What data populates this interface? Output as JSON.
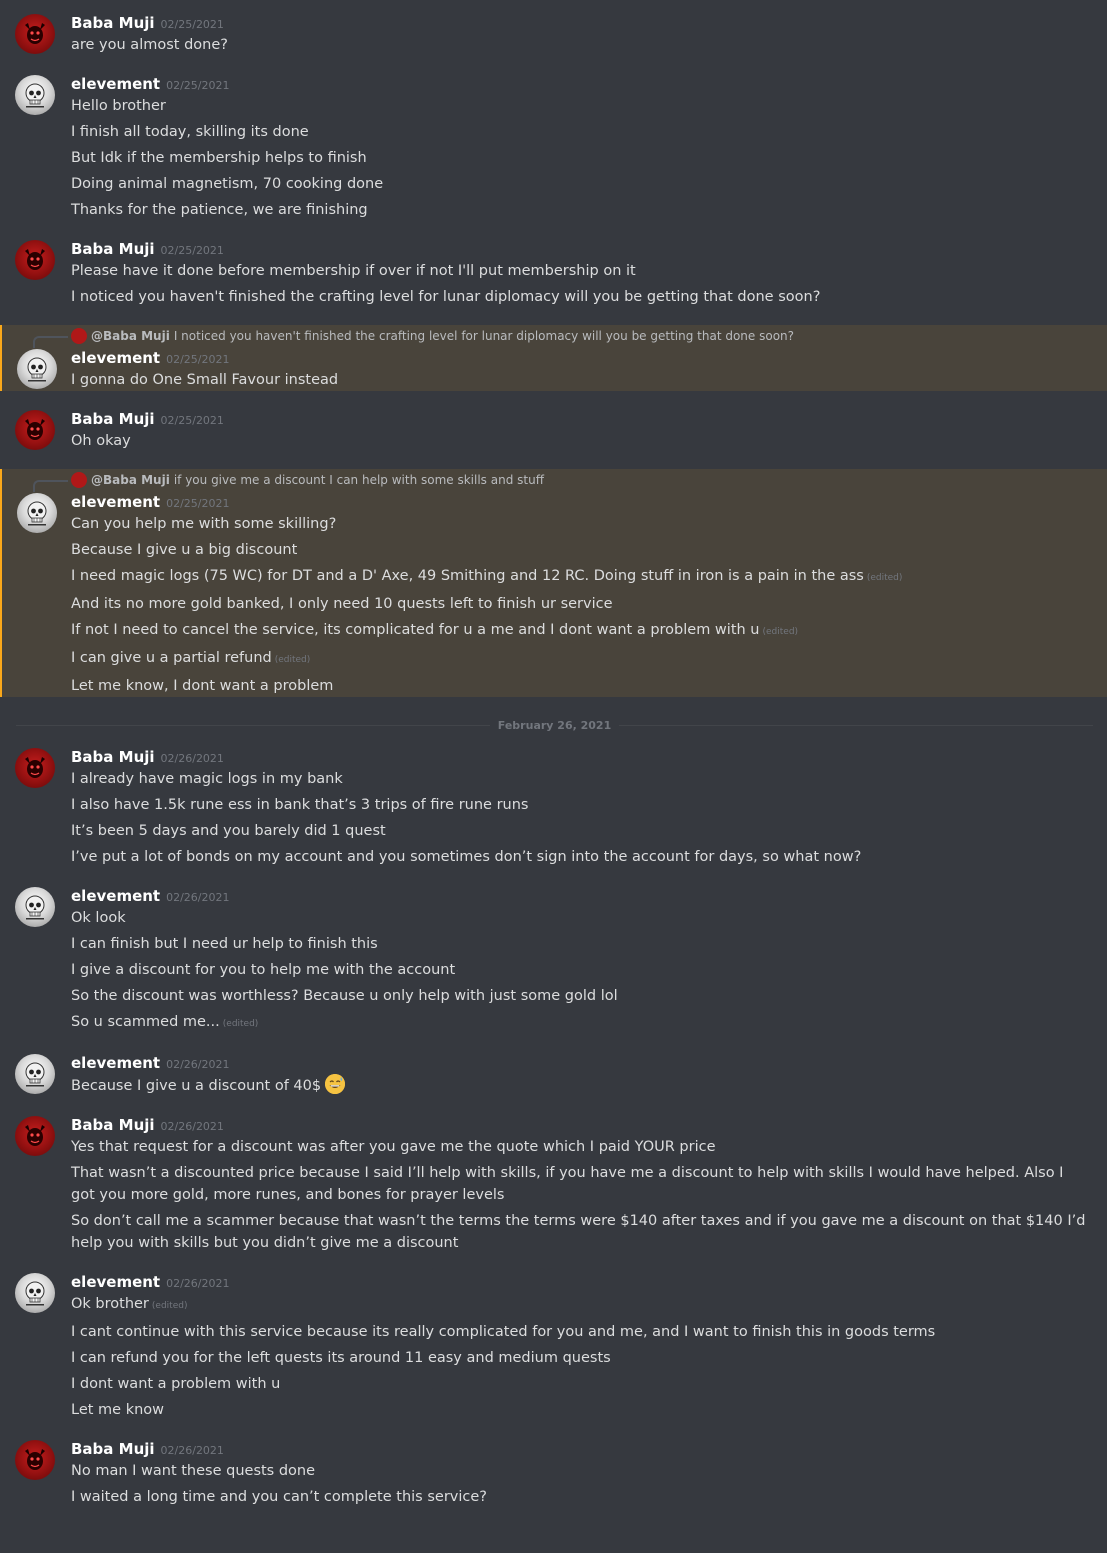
{
  "colors": {
    "background": "#36393f",
    "text": "#dcddde",
    "author": "#ffffff",
    "timestamp": "#72767d",
    "mention_highlight": "#faa81a",
    "baba_avatar": "#b01818",
    "elev_avatar": "#d9d9d9"
  },
  "edited_label": "(edited)",
  "date_divider": "February 26, 2021",
  "groups": [
    {
      "author": "Baba Muji",
      "avatar": "baba",
      "timestamp": "02/25/2021",
      "messages": [
        {
          "text": "are you almost done?"
        }
      ]
    },
    {
      "author": "elevement",
      "avatar": "elev",
      "timestamp": "02/25/2021",
      "messages": [
        {
          "text": "Hello brother"
        },
        {
          "text": "I finish all today, skilling its done"
        },
        {
          "text": "But Idk if the membership helps to finish"
        },
        {
          "text": "Doing animal magnetism, 70 cooking done"
        },
        {
          "text": "Thanks for the patience, we are finishing"
        }
      ]
    },
    {
      "author": "Baba Muji",
      "avatar": "baba",
      "timestamp": "02/25/2021",
      "messages": [
        {
          "text": "Please have it done before membership if over if not I'll put membership on it"
        },
        {
          "text": "I noticed you haven't finished the crafting level for lunar diplomacy will you be getting that done soon?"
        }
      ]
    },
    {
      "author": "elevement",
      "avatar": "elev",
      "timestamp": "02/25/2021",
      "reply": {
        "author": "@Baba Muji",
        "text": "I noticed you haven't finished the crafting level for lunar diplomacy will you be getting that done soon?"
      },
      "messages": [
        {
          "text": "I gonna do One Small Favour instead"
        }
      ]
    },
    {
      "author": "Baba Muji",
      "avatar": "baba",
      "timestamp": "02/25/2021",
      "messages": [
        {
          "text": "Oh okay"
        }
      ]
    },
    {
      "author": "elevement",
      "avatar": "elev",
      "timestamp": "02/25/2021",
      "reply": {
        "author": "@Baba Muji",
        "text": "if you give me a discount I can help with some skills and stuff"
      },
      "messages": [
        {
          "text": "Can you help me with some skilling?"
        },
        {
          "text": "Because I give u a big discount"
        },
        {
          "text": "I need magic logs (75 WC) for DT and a D' Axe, 49 Smithing and 12 RC. Doing stuff in iron is a pain in the ass",
          "edited": true
        },
        {
          "text": "And its no more gold banked, I only need 10 quests left to finish ur service"
        },
        {
          "text": "If not I need to cancel the service, its complicated for u a me and I dont want a problem with u",
          "edited": true
        },
        {
          "text": "I can give u a partial refund",
          "edited": true
        },
        {
          "text": "Let me know, I dont want a problem"
        }
      ]
    },
    {
      "divider": true
    },
    {
      "author": "Baba Muji",
      "avatar": "baba",
      "timestamp": "02/26/2021",
      "messages": [
        {
          "text": "I already have magic logs in my bank"
        },
        {
          "text": "I also have 1.5k rune ess in bank that’s 3 trips of fire rune runs"
        },
        {
          "text": "It’s been 5 days and you barely did 1 quest"
        },
        {
          "text": "I’ve put a lot of bonds on my account and you sometimes don’t sign into the account for days, so what now?"
        }
      ]
    },
    {
      "author": "elevement",
      "avatar": "elev",
      "timestamp": "02/26/2021",
      "messages": [
        {
          "text": "Ok look"
        },
        {
          "text": "I can finish but I need ur help to finish this"
        },
        {
          "text": "I give a discount for you to help me with the account"
        },
        {
          "text": "So the discount was worthless? Because u only help with just some gold lol"
        },
        {
          "text": "So u scammed me...",
          "edited": true
        }
      ]
    },
    {
      "author": "elevement",
      "avatar": "elev",
      "timestamp": "02/26/2021",
      "messages": [
        {
          "text": "Because I give u a discount of 40$",
          "emoji": "grinning-sweat-emoji"
        }
      ]
    },
    {
      "author": "Baba Muji",
      "avatar": "baba",
      "timestamp": "02/26/2021",
      "messages": [
        {
          "text": "Yes that request for a discount was after you gave me the quote which I paid YOUR price"
        },
        {
          "text": "That wasn’t a discounted price because I said I’ll help with skills, if you have me a discount to help with skills I would have helped. Also I got you more gold, more runes, and bones for prayer levels"
        },
        {
          "text": "So don’t call me a scammer because that wasn’t the terms the terms were $140 after taxes and if you gave me a discount on that $140 I’d help you with skills but you didn’t give me a discount"
        }
      ]
    },
    {
      "author": "elevement",
      "avatar": "elev",
      "timestamp": "02/26/2021",
      "messages": [
        {
          "text": "Ok brother",
          "edited": true
        },
        {
          "text": "I cant continue with this service because its really complicated for you and me, and I want to finish this in goods terms"
        },
        {
          "text": "I can refund you for the left quests its around 11 easy and medium quests"
        },
        {
          "text": "I dont want a problem with u"
        },
        {
          "text": "Let me know"
        }
      ]
    },
    {
      "author": "Baba Muji",
      "avatar": "baba",
      "timestamp": "02/26/2021",
      "messages": [
        {
          "text": "No man I want these quests done"
        },
        {
          "text": "I waited a long time and you can’t complete this service?"
        }
      ]
    }
  ]
}
